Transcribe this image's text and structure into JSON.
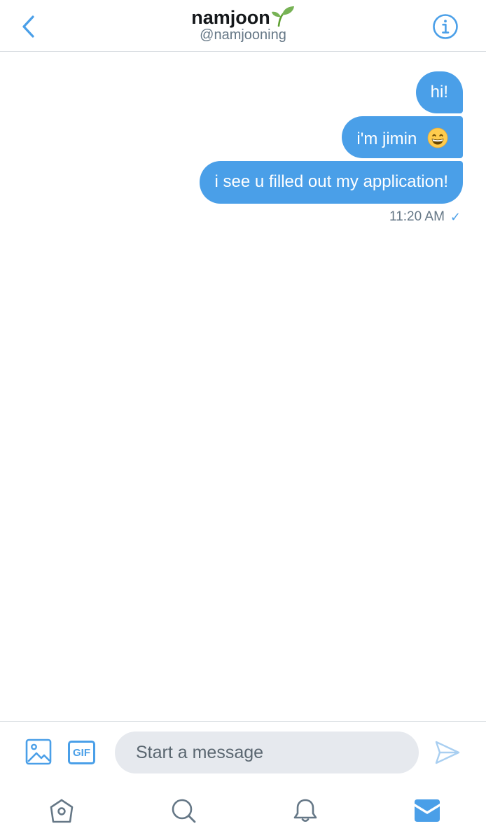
{
  "header": {
    "name": "namjoon",
    "handle": "@namjooning"
  },
  "messages": [
    {
      "text": "hi!"
    },
    {
      "text": "i'm jimin",
      "emoji": "grinning-face-icon"
    },
    {
      "text": "i see u filled out my application!"
    }
  ],
  "timestamp": "11:20 AM",
  "composer": {
    "placeholder": "Start a message",
    "gif_label": "GIF"
  },
  "colors": {
    "accent": "#4a9fe8",
    "bubble": "#4a9fe8",
    "input_bg": "#e6e9ee",
    "secondary_text": "#657786"
  },
  "icons": {
    "back": "chevron-left-icon",
    "info": "info-icon",
    "title_emoji": "seedling-icon",
    "media": "image-icon",
    "send": "send-icon",
    "tabs": [
      "home-icon",
      "search-icon",
      "bell-icon",
      "mail-icon"
    ],
    "active_tab": "mail-icon"
  }
}
